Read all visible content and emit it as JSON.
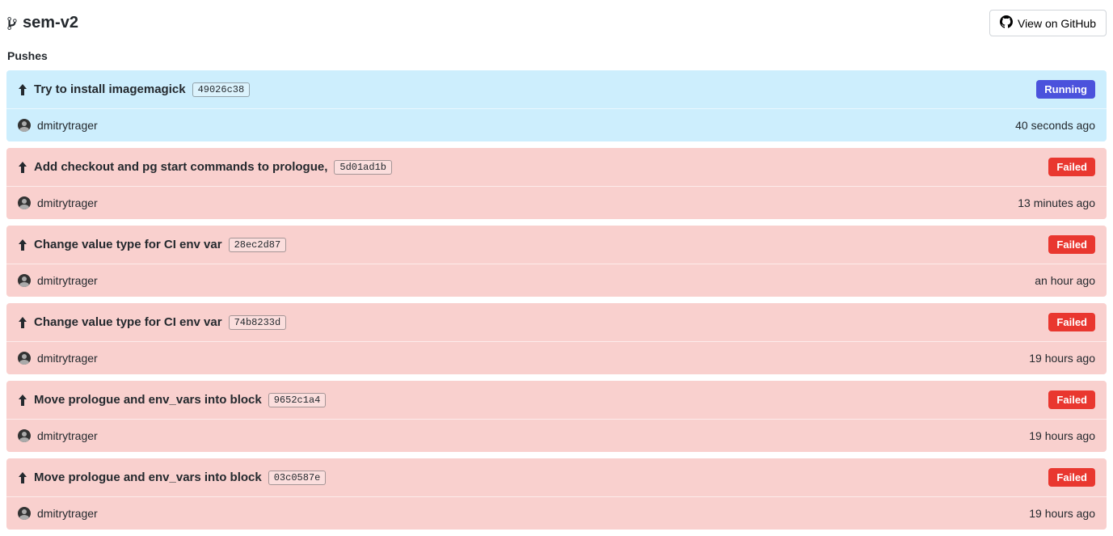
{
  "header": {
    "branch_name": "sem-v2",
    "github_button_label": "View on GitHub"
  },
  "section_title": "Pushes",
  "pushes": [
    {
      "title": "Try to install imagemagick",
      "commit": "49026c38",
      "status": "Running",
      "status_class": "running",
      "author": "dmitrytrager",
      "time": "40 seconds ago"
    },
    {
      "title": "Add checkout and pg start commands to prologue,",
      "commit": "5d01ad1b",
      "status": "Failed",
      "status_class": "failed",
      "author": "dmitrytrager",
      "time": "13 minutes ago"
    },
    {
      "title": "Change value type for CI env var",
      "commit": "28ec2d87",
      "status": "Failed",
      "status_class": "failed",
      "author": "dmitrytrager",
      "time": "an hour ago"
    },
    {
      "title": "Change value type for CI env var",
      "commit": "74b8233d",
      "status": "Failed",
      "status_class": "failed",
      "author": "dmitrytrager",
      "time": "19 hours ago"
    },
    {
      "title": "Move prologue and env_vars into block",
      "commit": "9652c1a4",
      "status": "Failed",
      "status_class": "failed",
      "author": "dmitrytrager",
      "time": "19 hours ago"
    },
    {
      "title": "Move prologue and env_vars into block",
      "commit": "03c0587e",
      "status": "Failed",
      "status_class": "failed",
      "author": "dmitrytrager",
      "time": "19 hours ago"
    }
  ]
}
